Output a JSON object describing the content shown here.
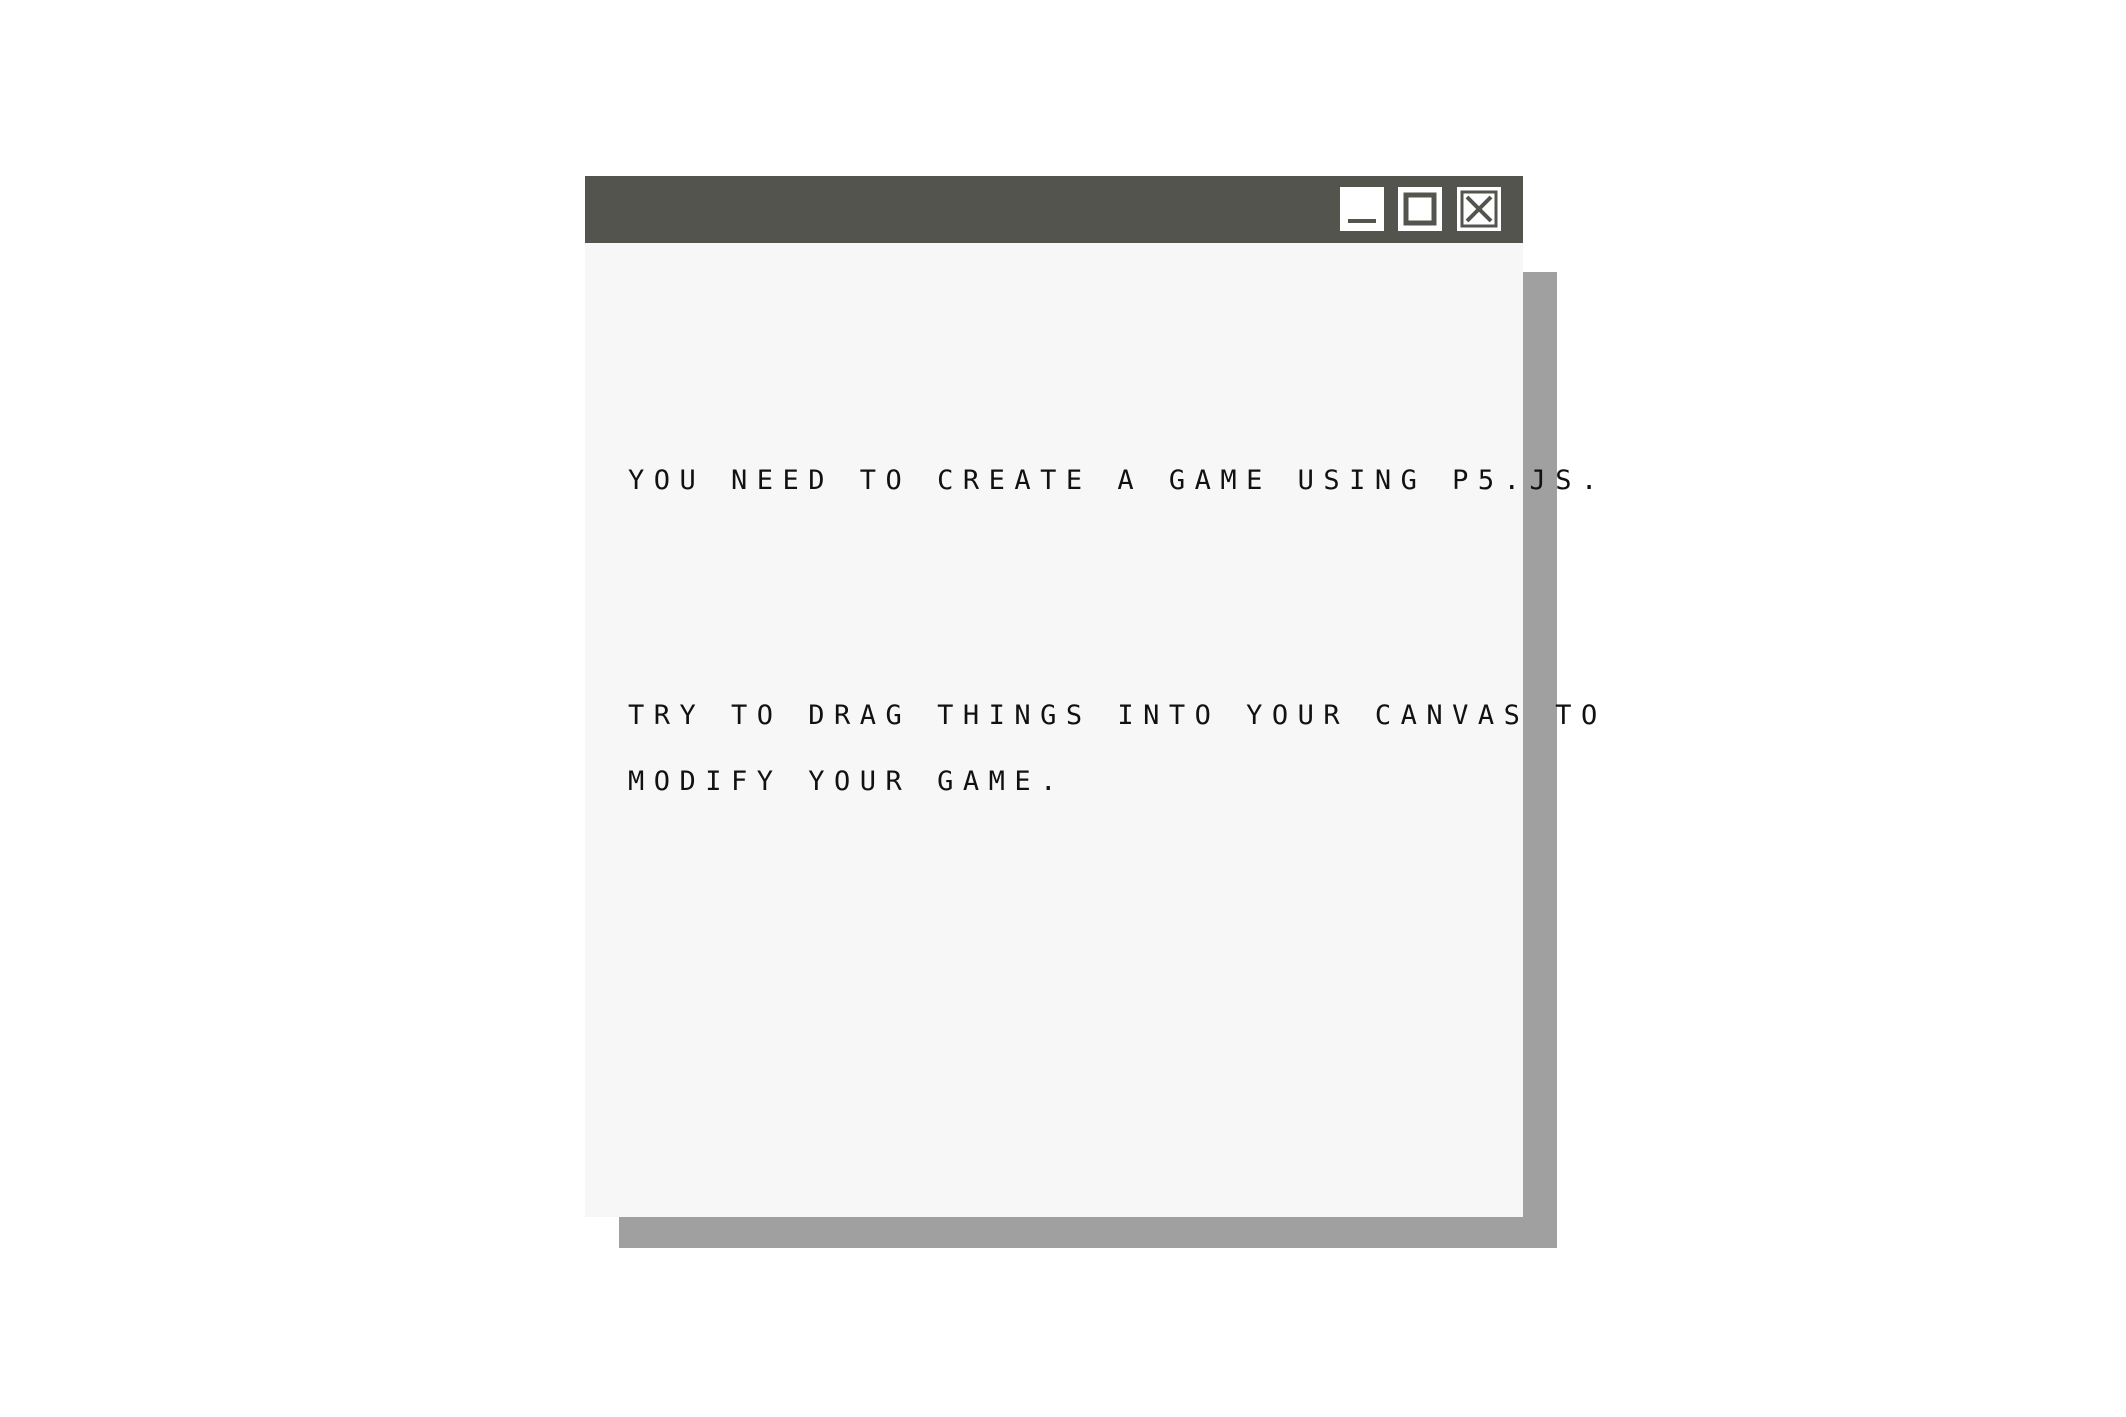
{
  "window": {
    "controls": {
      "minimize_icon": "minimize-icon",
      "maximize_icon": "maximize-icon",
      "close_icon": "close-icon"
    }
  },
  "content": {
    "paragraph_1": "YOU NEED TO CREATE A GAME USING P5.JS.",
    "paragraph_2_line_1": "TRY TO DRAG THINGS INTO YOUR CANVAS TO",
    "paragraph_2_line_2": "MODIFY YOUR GAME."
  },
  "colors": {
    "background": "#ffffff",
    "titlebar": "#54544f",
    "window_body": "#f7f7f7",
    "shadow": "#a0a0a0",
    "text": "#111111"
  }
}
